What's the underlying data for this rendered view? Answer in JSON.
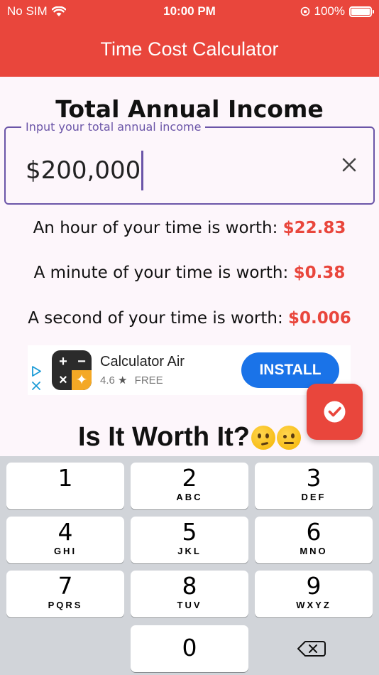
{
  "status_bar": {
    "carrier": "No SIM",
    "time": "10:00 PM",
    "battery": "100%"
  },
  "app_bar": {
    "title": "Time Cost Calculator"
  },
  "income": {
    "heading": "Total Annual Income",
    "label": "Input your total annual income",
    "value": "$200,000"
  },
  "worth": {
    "hour_label": "An hour of your time is worth: ",
    "hour_value": "$22.83",
    "minute_label": "A minute of your time is worth: ",
    "minute_value": "$0.38",
    "second_label": "A second of your time is worth: ",
    "second_value": "$0.006"
  },
  "ad": {
    "app_name": "Calculator Air",
    "rating": "4.6",
    "price": "FREE",
    "install_label": "INSTALL"
  },
  "question": {
    "heading": "Is It Worth It?"
  },
  "keyboard": {
    "keys": [
      {
        "num": "1",
        "letters": ""
      },
      {
        "num": "2",
        "letters": "ABC"
      },
      {
        "num": "3",
        "letters": "DEF"
      },
      {
        "num": "4",
        "letters": "GHI"
      },
      {
        "num": "5",
        "letters": "JKL"
      },
      {
        "num": "6",
        "letters": "MNO"
      },
      {
        "num": "7",
        "letters": "PQRS"
      },
      {
        "num": "8",
        "letters": "TUV"
      },
      {
        "num": "9",
        "letters": "WXYZ"
      },
      {
        "num": "0",
        "letters": ""
      }
    ]
  },
  "colors": {
    "accent": "#e9463c",
    "outline": "#6b55a8",
    "install": "#1a73e8"
  }
}
